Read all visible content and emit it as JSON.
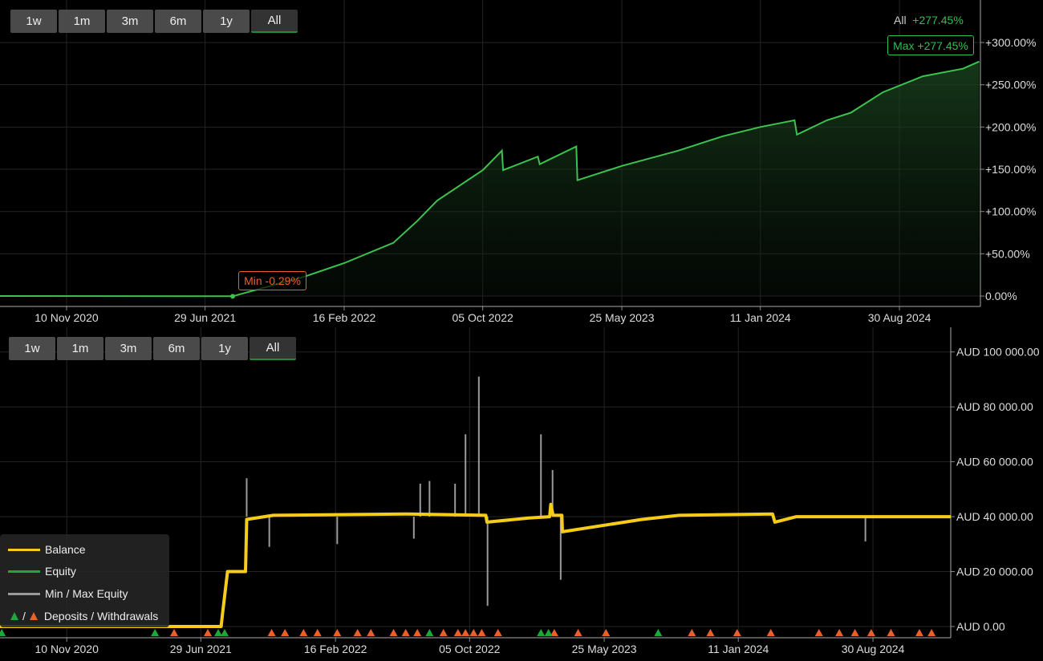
{
  "top_ranges": [
    "1w",
    "1m",
    "3m",
    "6m",
    "1y",
    "All"
  ],
  "bottom_ranges": [
    "1w",
    "1m",
    "3m",
    "6m",
    "1y",
    "All"
  ],
  "active_range": "All",
  "summary": {
    "label": "All",
    "value": "+277.45%"
  },
  "max_label": "Max +277.45%",
  "min_label": "Min -0.29%",
  "legend": {
    "balance": "Balance",
    "equity": "Equity",
    "minmax": "Min / Max Equity",
    "slash": "/",
    "deposits": "Deposits / Withdrawals"
  },
  "colors": {
    "growth": "#3cc24f",
    "balance": "#f5cc1a",
    "equity": "#1fa83a",
    "minmax": "#9a9a9a",
    "deposit": "#1fa83a",
    "withdrawal": "#e8602c",
    "grid": "#242424"
  },
  "chart_data": [
    {
      "type": "area",
      "xlim": [
        "2020-07-22",
        "2025-01-12"
      ],
      "ylim": [
        -12.3,
        350.3
      ],
      "grid": true,
      "x_ticks": [
        {
          "date": "2020-11-10",
          "label": "10 Nov 2020"
        },
        {
          "date": "2021-06-29",
          "label": "29 Jun 2021"
        },
        {
          "date": "2022-02-16",
          "label": "16 Feb 2022"
        },
        {
          "date": "2022-10-05",
          "label": "05 Oct 2022"
        },
        {
          "date": "2023-05-25",
          "label": "25 May 2023"
        },
        {
          "date": "2024-01-11",
          "label": "11 Jan 2024"
        },
        {
          "date": "2024-08-30",
          "label": "30 Aug 2024"
        }
      ],
      "y_ticks": [
        {
          "value": 0,
          "label": "0.00%"
        },
        {
          "value": 50,
          "label": "+50.00%"
        },
        {
          "value": 100,
          "label": "+100.00%"
        },
        {
          "value": 150,
          "label": "+150.00%"
        },
        {
          "value": 200,
          "label": "+200.00%"
        },
        {
          "value": 250,
          "label": "+250.00%"
        },
        {
          "value": 300,
          "label": "+300.00%"
        }
      ],
      "series": [
        {
          "points": [
            [
              "2020-07-22",
              0
            ],
            [
              "2021-08-14",
              -0.29
            ],
            [
              "2021-12-12",
              23
            ],
            [
              "2022-02-16",
              39
            ],
            [
              "2022-05-09",
              63
            ],
            [
              "2022-06-18",
              89
            ],
            [
              "2022-07-21",
              113
            ],
            [
              "2022-10-05",
              149
            ],
            [
              "2022-11-06",
              172
            ],
            [
              "2022-11-08",
              149
            ],
            [
              "2023-01-05",
              165
            ],
            [
              "2023-01-08",
              156
            ],
            [
              "2023-03-10",
              177
            ],
            [
              "2023-03-12",
              137
            ],
            [
              "2023-05-25",
              154
            ],
            [
              "2023-08-27",
              172
            ],
            [
              "2023-11-09",
              189
            ],
            [
              "2024-01-11",
              200
            ],
            [
              "2024-03-08",
              208
            ],
            [
              "2024-03-12",
              191
            ],
            [
              "2024-05-01",
              208
            ],
            [
              "2024-06-10",
              217
            ],
            [
              "2024-08-02",
              241
            ],
            [
              "2024-10-08",
              260
            ],
            [
              "2024-12-14",
              269
            ],
            [
              "2025-01-10",
              277.45
            ]
          ]
        }
      ],
      "min_point": [
        "2021-08-14",
        -0.29
      ],
      "max_point": [
        "2025-01-10",
        277.45
      ]
    },
    {
      "type": "line",
      "xlim": [
        "2020-07-18",
        "2025-01-11"
      ],
      "ylim": [
        -4100,
        108400
      ],
      "grid": true,
      "legend_position": "bottom-left",
      "x_ticks": [
        {
          "date": "2020-11-10",
          "label": "10 Nov 2020"
        },
        {
          "date": "2021-06-29",
          "label": "29 Jun 2021"
        },
        {
          "date": "2022-02-16",
          "label": "16 Feb 2022"
        },
        {
          "date": "2022-10-05",
          "label": "05 Oct 2022"
        },
        {
          "date": "2023-05-25",
          "label": "25 May 2023"
        },
        {
          "date": "2024-01-11",
          "label": "11 Jan 2024"
        },
        {
          "date": "2024-08-30",
          "label": "30 Aug 2024"
        }
      ],
      "y_ticks": [
        {
          "value": 0,
          "label": "AUD 0.00"
        },
        {
          "value": 20000,
          "label": "AUD 20 000.00"
        },
        {
          "value": 40000,
          "label": "AUD 40 000.00"
        },
        {
          "value": 60000,
          "label": "AUD 60 000.00"
        },
        {
          "value": 80000,
          "label": "AUD 80 000.00"
        },
        {
          "value": 100000,
          "label": "AUD 100 000.00"
        }
      ],
      "balance": [
        [
          "2020-07-18",
          0
        ],
        [
          "2021-08-03",
          0
        ],
        [
          "2021-08-05",
          4000
        ],
        [
          "2021-08-14",
          20000
        ],
        [
          "2021-09-14",
          20000
        ],
        [
          "2021-09-16",
          39000
        ],
        [
          "2021-11-01",
          40500
        ],
        [
          "2022-06-15",
          41000
        ],
        [
          "2022-11-02",
          40500
        ],
        [
          "2022-11-04",
          38000
        ],
        [
          "2023-01-15",
          39500
        ],
        [
          "2023-02-20",
          40000
        ],
        [
          "2023-02-22",
          44500
        ],
        [
          "2023-02-26",
          40500
        ],
        [
          "2023-03-13",
          40500
        ],
        [
          "2023-03-14",
          34500
        ],
        [
          "2023-07-29",
          39000
        ],
        [
          "2023-10-01",
          40500
        ],
        [
          "2024-03-10",
          41000
        ],
        [
          "2024-03-14",
          38000
        ],
        [
          "2024-04-20",
          40000
        ],
        [
          "2025-01-11",
          40000
        ]
      ],
      "minmax_spikes": [
        [
          "2021-09-16",
          54000
        ],
        [
          "2021-10-25",
          29000
        ],
        [
          "2022-02-19",
          30000
        ],
        [
          "2022-07-01",
          32000
        ],
        [
          "2022-07-12",
          52000
        ],
        [
          "2022-07-28",
          53000
        ],
        [
          "2022-09-10",
          52000
        ],
        [
          "2022-09-28",
          70000
        ],
        [
          "2022-10-21",
          91000
        ],
        [
          "2022-11-05",
          7500
        ],
        [
          "2023-02-05",
          70000
        ],
        [
          "2023-02-25",
          57000
        ],
        [
          "2023-03-11",
          17000
        ],
        [
          "2024-08-17",
          31000
        ]
      ],
      "deposits": [
        "2020-07-21",
        "2021-04-11",
        "2021-07-29",
        "2021-08-09",
        "2022-07-28",
        "2023-02-05",
        "2023-02-18",
        "2023-08-26"
      ],
      "withdrawals": [
        "2021-05-14",
        "2021-07-11",
        "2021-10-29",
        "2021-11-21",
        "2021-12-23",
        "2022-01-16",
        "2022-02-19",
        "2022-03-26",
        "2022-04-18",
        "2022-05-27",
        "2022-06-17",
        "2022-07-07",
        "2022-08-21",
        "2022-09-15",
        "2022-09-28",
        "2022-10-12",
        "2022-10-26",
        "2022-11-23",
        "2023-02-28",
        "2023-04-10",
        "2023-05-28",
        "2023-10-23",
        "2023-11-24",
        "2024-01-09",
        "2024-03-07",
        "2024-05-29",
        "2024-07-03",
        "2024-07-30",
        "2024-08-27",
        "2024-09-30",
        "2024-11-18",
        "2024-12-09"
      ]
    }
  ]
}
